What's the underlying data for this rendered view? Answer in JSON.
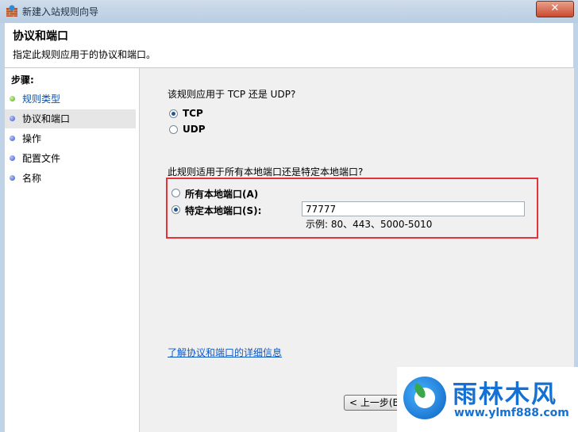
{
  "window": {
    "title": "新建入站规则向导",
    "close_label": "✕"
  },
  "header": {
    "title": "协议和端口",
    "subtitle": "指定此规则应用于的协议和端口。"
  },
  "steps": {
    "heading": "步骤:",
    "items": [
      {
        "label": "规则类型",
        "state": "done"
      },
      {
        "label": "协议和端口",
        "state": "active"
      },
      {
        "label": "操作",
        "state": "pending"
      },
      {
        "label": "配置文件",
        "state": "pending"
      },
      {
        "label": "名称",
        "state": "pending"
      }
    ]
  },
  "protocol": {
    "question": "该规则应用于 TCP 还是 UDP?",
    "options": [
      {
        "label": "TCP",
        "checked": true
      },
      {
        "label": "UDP",
        "checked": false
      }
    ]
  },
  "ports": {
    "question": "此规则适用于所有本地端口还是特定本地端口?",
    "all_label": "所有本地端口(A)",
    "specific_label": "特定本地端口(S):",
    "selected": "specific",
    "value": "77777",
    "example": "示例: 80、443、5000-5010"
  },
  "link": {
    "label": "了解协议和端口的详细信息"
  },
  "buttons": {
    "back": "< 上一步(B"
  },
  "watermark": {
    "name": "雨林木风",
    "url": "www.ylmf888.com"
  },
  "colors": {
    "highlight_box": "#e4333a",
    "link": "#0b58c9",
    "watermark": "#1570d4"
  }
}
